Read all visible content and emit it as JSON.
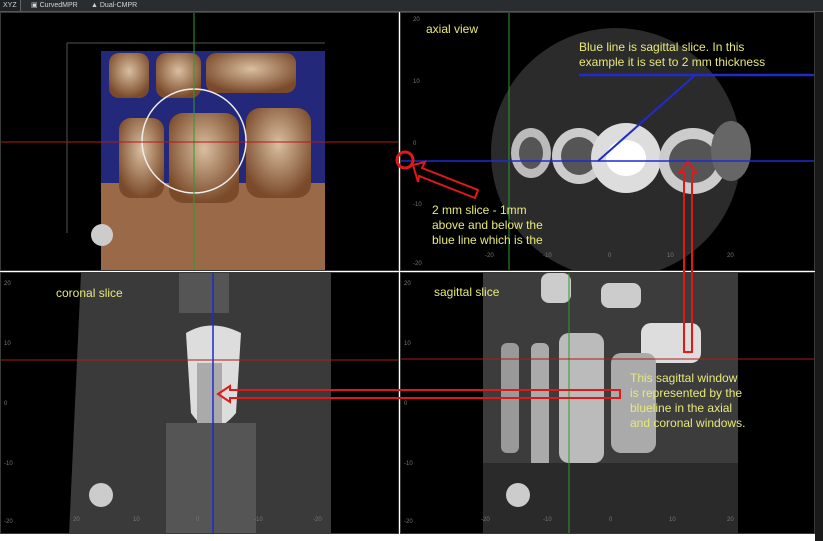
{
  "tabs": [
    {
      "label": "XYZ",
      "active": true
    },
    {
      "label": "CurvedMPR",
      "icon": "curve-icon"
    },
    {
      "label": "Dual-CMPR",
      "icon": "dual-icon"
    }
  ],
  "panes": {
    "volume": {
      "name": "3D volume"
    },
    "axial": {
      "title": "axial view",
      "left_ticks": [
        "20",
        "10",
        "0",
        "-10",
        "-20"
      ],
      "bottom_ticks": [
        "-20",
        "-10",
        "0",
        "10",
        "20"
      ]
    },
    "coronal": {
      "title": "coronal slice",
      "left_ticks": [
        "20",
        "10",
        "0",
        "-10",
        "-20"
      ],
      "bottom_ticks": [
        "20",
        "10",
        "0",
        "-10",
        "-20"
      ]
    },
    "sagittal": {
      "title": "sagittal slice",
      "left_ticks": [
        "20",
        "10",
        "0",
        "-10",
        "-20"
      ],
      "bottom_ticks": [
        "-20",
        "-10",
        "0",
        "10",
        "20"
      ]
    }
  },
  "annotations": {
    "blue_line": [
      "Blue line is sagittal slice. In this",
      "example it is set to  2 mm thickness"
    ],
    "slice": [
      "2 mm slice - 1mm",
      "above and below the",
      "blue line which is the"
    ],
    "sagittal_window": [
      "This sagittal window",
      "is represented by the",
      "blueline in the axial",
      "and coronal windows."
    ]
  },
  "colors": {
    "annotation": "#e8e87a",
    "arrow": "#e01818",
    "sagittal_line": "#1f2bd0",
    "crosshair_green": "#2e9a2e",
    "crosshair_red": "#b01a1a"
  }
}
